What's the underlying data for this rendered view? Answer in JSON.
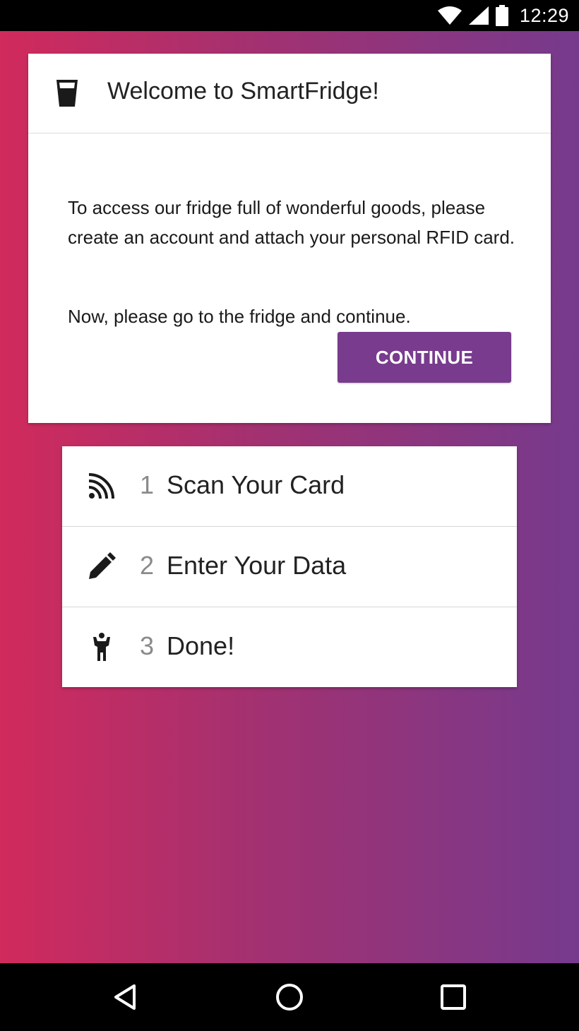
{
  "status_bar": {
    "time": "12:29",
    "icons": [
      "wifi-icon",
      "signal-icon",
      "battery-icon"
    ]
  },
  "welcome": {
    "icon": "cup-icon",
    "title": "Welcome to SmartFridge!",
    "paragraph1": "To access our fridge full of wonderful goods, please create an account and attach your personal RFID card.",
    "paragraph2": "Now, please go to the fridge and continue.",
    "continue_label": "CONTINUE"
  },
  "steps": [
    {
      "number": "1",
      "label": "Scan Your Card",
      "icon": "rfid-icon"
    },
    {
      "number": "2",
      "label": "Enter Your Data",
      "icon": "pencil-icon"
    },
    {
      "number": "3",
      "label": "Done!",
      "icon": "person-icon"
    }
  ],
  "nav": [
    "back-icon",
    "home-icon",
    "recents-icon"
  ],
  "colors": {
    "accent": "#783b8d",
    "gradient_start": "#d12a5c",
    "gradient_end": "#763a8d"
  }
}
